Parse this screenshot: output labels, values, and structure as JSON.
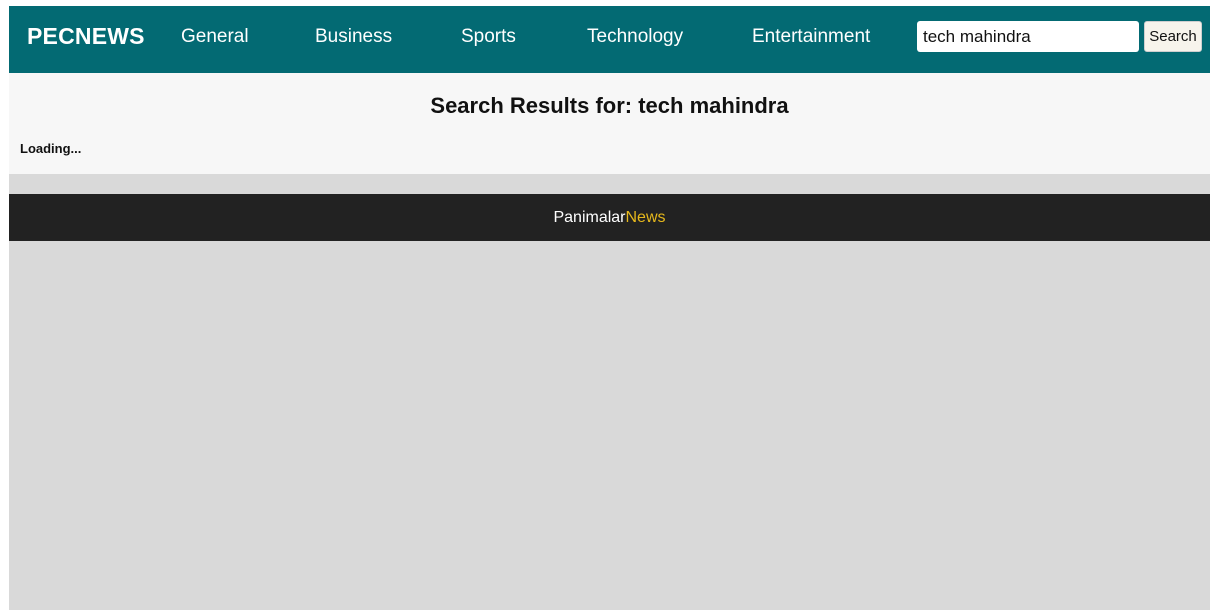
{
  "navbar": {
    "brand": "PECNEWS",
    "links": [
      {
        "label": "General"
      },
      {
        "label": "Business"
      },
      {
        "label": "Sports"
      },
      {
        "label": "Technology"
      },
      {
        "label": "Entertainment"
      }
    ],
    "search": {
      "value": "tech mahindra",
      "button_label": "Search"
    }
  },
  "results": {
    "title": "Search Results for: tech mahindra",
    "status": "Loading..."
  },
  "footer": {
    "brand_part1": "Panimalar",
    "brand_part2": "News"
  },
  "colors": {
    "navbar_bg": "#036a73",
    "footer_bg": "#222222",
    "footer_accent": "#e6b81c",
    "page_bg": "#d9d9d9"
  }
}
